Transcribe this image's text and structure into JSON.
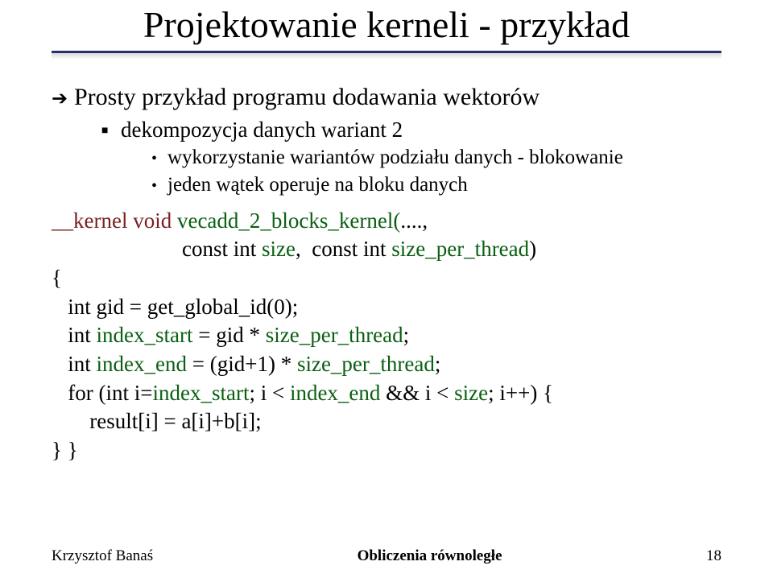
{
  "title": "Projektowanie kerneli - przykład",
  "bullet_main": "Prosty przykład programu dodawania wektorów",
  "sub1": "dekompozycja danych wariant 2",
  "sub2a": "wykorzystanie wariantów podziału danych - blokowanie",
  "sub2b": "jeden wątek operuje na bloku danych",
  "code": {
    "l1_a": "__kernel void",
    "l1_b": " ",
    "l1_c": "vecadd_2_blocks_kernel(",
    "l1_d": "...., ",
    "l2_a": "                        const int ",
    "l2_b": "size",
    "l2_c": ",  const int ",
    "l2_d": "size_per_thread",
    "l2_e": ")",
    "l3": "{",
    "l4": "   int gid = get_global_id(0);",
    "l5_a": "   int ",
    "l5_b": "index_start",
    "l5_c": " = gid * ",
    "l5_d": "size_per_thread",
    "l5_e": ";",
    "l6_a": "   int ",
    "l6_b": "index_end",
    "l6_c": " = (gid+1) * ",
    "l6_d": "size_per_thread",
    "l6_e": ";",
    "l7_a": "   for (int i=",
    "l7_b": "index_start",
    "l7_c": "; i < ",
    "l7_d": "index_end",
    "l7_e": " && i < ",
    "l7_f": "size",
    "l7_g": "; i++) {",
    "l8": "       result[i] = a[i]+b[i];",
    "l9": "} }"
  },
  "footer": {
    "left": "Krzysztof Banaś",
    "center": "Obliczenia równoległe",
    "right": "18"
  }
}
